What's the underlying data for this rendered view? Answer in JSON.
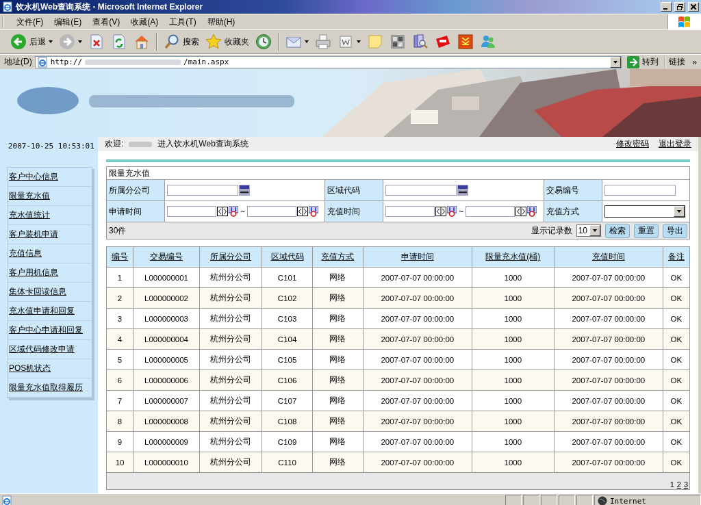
{
  "window": {
    "title": "饮水机Web查询系统 - Microsoft Internet Explorer"
  },
  "menu": [
    "文件(F)",
    "编辑(E)",
    "查看(V)",
    "收藏(A)",
    "工具(T)",
    "帮助(H)"
  ],
  "toolbar": [
    {
      "kind": "back",
      "label": "后退",
      "dropdown": true
    },
    {
      "kind": "forward",
      "dropdown": true
    },
    {
      "kind": "stop",
      "dropdown": false
    },
    {
      "kind": "refresh",
      "dropdown": false
    },
    {
      "kind": "home",
      "dropdown": false
    },
    {
      "kind": "separator"
    },
    {
      "kind": "search",
      "label": "搜索",
      "dropdown": false
    },
    {
      "kind": "favorites",
      "label": "收藏夹",
      "dropdown": false
    },
    {
      "kind": "history",
      "dropdown": false
    },
    {
      "kind": "separator"
    },
    {
      "kind": "mail",
      "dropdown": true
    },
    {
      "kind": "print",
      "dropdown": false
    },
    {
      "kind": "edit",
      "dropdown": true
    },
    {
      "kind": "note",
      "dropdown": false
    },
    {
      "kind": "app",
      "dropdown": false
    },
    {
      "kind": "research",
      "dropdown": false
    },
    {
      "kind": "badge",
      "dropdown": false
    },
    {
      "kind": "download",
      "dropdown": false
    },
    {
      "kind": "messenger",
      "dropdown": false
    }
  ],
  "address": {
    "label": "地址(D)",
    "url_start": "http://",
    "url_end": "/main.aspx",
    "go": "转到",
    "links": "链接",
    "more": "»"
  },
  "sidebar": {
    "datetime": "2007-10-25 10:53:01",
    "items": [
      "客户中心信息",
      "限量充水值",
      "充水值统计",
      "客户装机申请",
      "充值信息",
      "客户用机信息",
      "集体卡回读信息",
      "充水值申请和回复",
      "客户中心申请和回复",
      "区域代码修改申请",
      "POS机状态",
      "限量充水值取得履历"
    ]
  },
  "header": {
    "welcome_prefix": "欢迎:",
    "welcome_suffix": "进入饮水机Web查询系统",
    "links": [
      "修改密码",
      "退出登录"
    ]
  },
  "form": {
    "title": "限量充水值",
    "rows": [
      [
        {
          "label": "所属分公司",
          "kind": "lookup"
        },
        {
          "label": "区域代码",
          "kind": "lookup"
        },
        {
          "label": "交易编号",
          "kind": "text"
        }
      ],
      [
        {
          "label": "申请时间",
          "kind": "daterange",
          "separator": "~"
        },
        {
          "label": "充值时间",
          "kind": "daterange",
          "separator": "~"
        },
        {
          "label": "充值方式",
          "kind": "select"
        }
      ]
    ],
    "count": "30件",
    "page_size_label": "显示记录数",
    "page_size": "10",
    "buttons": [
      "检索",
      "重置",
      "导出"
    ]
  },
  "table": {
    "columns": [
      "编号",
      "交易编号",
      "所属分公司",
      "区域代码",
      "充值方式",
      "申请时间",
      "限量充水值(桶)",
      "充值时间",
      "备注"
    ],
    "rows": [
      [
        "1",
        "L000000001",
        "杭州分公司",
        "C101",
        "网络",
        "2007-07-07 00:00:00",
        "1000",
        "2007-07-07 00:00:00",
        "OK"
      ],
      [
        "2",
        "L000000002",
        "杭州分公司",
        "C102",
        "网络",
        "2007-07-07 00:00:00",
        "1000",
        "2007-07-07 00:00:00",
        "OK"
      ],
      [
        "3",
        "L000000003",
        "杭州分公司",
        "C103",
        "网络",
        "2007-07-07 00:00:00",
        "1000",
        "2007-07-07 00:00:00",
        "OK"
      ],
      [
        "4",
        "L000000004",
        "杭州分公司",
        "C104",
        "网络",
        "2007-07-07 00:00:00",
        "1000",
        "2007-07-07 00:00:00",
        "OK"
      ],
      [
        "5",
        "L000000005",
        "杭州分公司",
        "C105",
        "网络",
        "2007-07-07 00:00:00",
        "1000",
        "2007-07-07 00:00:00",
        "OK"
      ],
      [
        "6",
        "L000000006",
        "杭州分公司",
        "C106",
        "网络",
        "2007-07-07 00:00:00",
        "1000",
        "2007-07-07 00:00:00",
        "OK"
      ],
      [
        "7",
        "L000000007",
        "杭州分公司",
        "C107",
        "网络",
        "2007-07-07 00:00:00",
        "1000",
        "2007-07-07 00:00:00",
        "OK"
      ],
      [
        "8",
        "L000000008",
        "杭州分公司",
        "C108",
        "网络",
        "2007-07-07 00:00:00",
        "1000",
        "2007-07-07 00:00:00",
        "OK"
      ],
      [
        "9",
        "L000000009",
        "杭州分公司",
        "C109",
        "网络",
        "2007-07-07 00:00:00",
        "1000",
        "2007-07-07 00:00:00",
        "OK"
      ],
      [
        "10",
        "L000000010",
        "杭州分公司",
        "C110",
        "网络",
        "2007-07-07 00:00:00",
        "1000",
        "2007-07-07 00:00:00",
        "OK"
      ]
    ]
  },
  "pagination": [
    {
      "label": "1",
      "selected": true
    },
    {
      "label": "2",
      "selected": false
    },
    {
      "label": "3",
      "selected": false
    }
  ],
  "status_bar": {
    "zone": "Internet"
  }
}
